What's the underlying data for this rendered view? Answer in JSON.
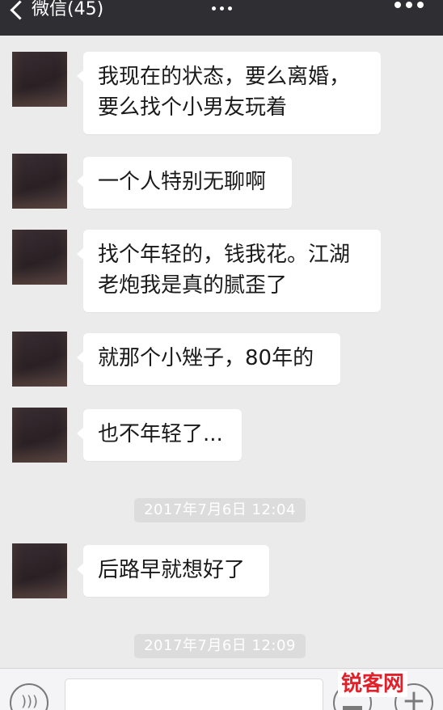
{
  "topbar": {
    "back_label": "微信(45)"
  },
  "messages": [
    {
      "text": "我现在的状态，要么离婚，\n要么找个小男友玩着"
    },
    {
      "text": "一个人特别无聊啊"
    },
    {
      "text": "找个年轻的，钱我花。江湖\n老炮我是真的腻歪了"
    },
    {
      "text": "就那个小矬子，80年的"
    },
    {
      "text": "也不年轻了..."
    },
    {
      "text": "后路早就想好了"
    }
  ],
  "timestamps": [
    "2017年7月6日 12:04",
    "2017年7月6日 12:09"
  ],
  "watermark": "锐客网",
  "colors": {
    "topbar_bg": "#2f2f33",
    "chat_bg": "#ebebeb",
    "bubble_bg": "#ffffff",
    "watermark": "#e2202a"
  }
}
